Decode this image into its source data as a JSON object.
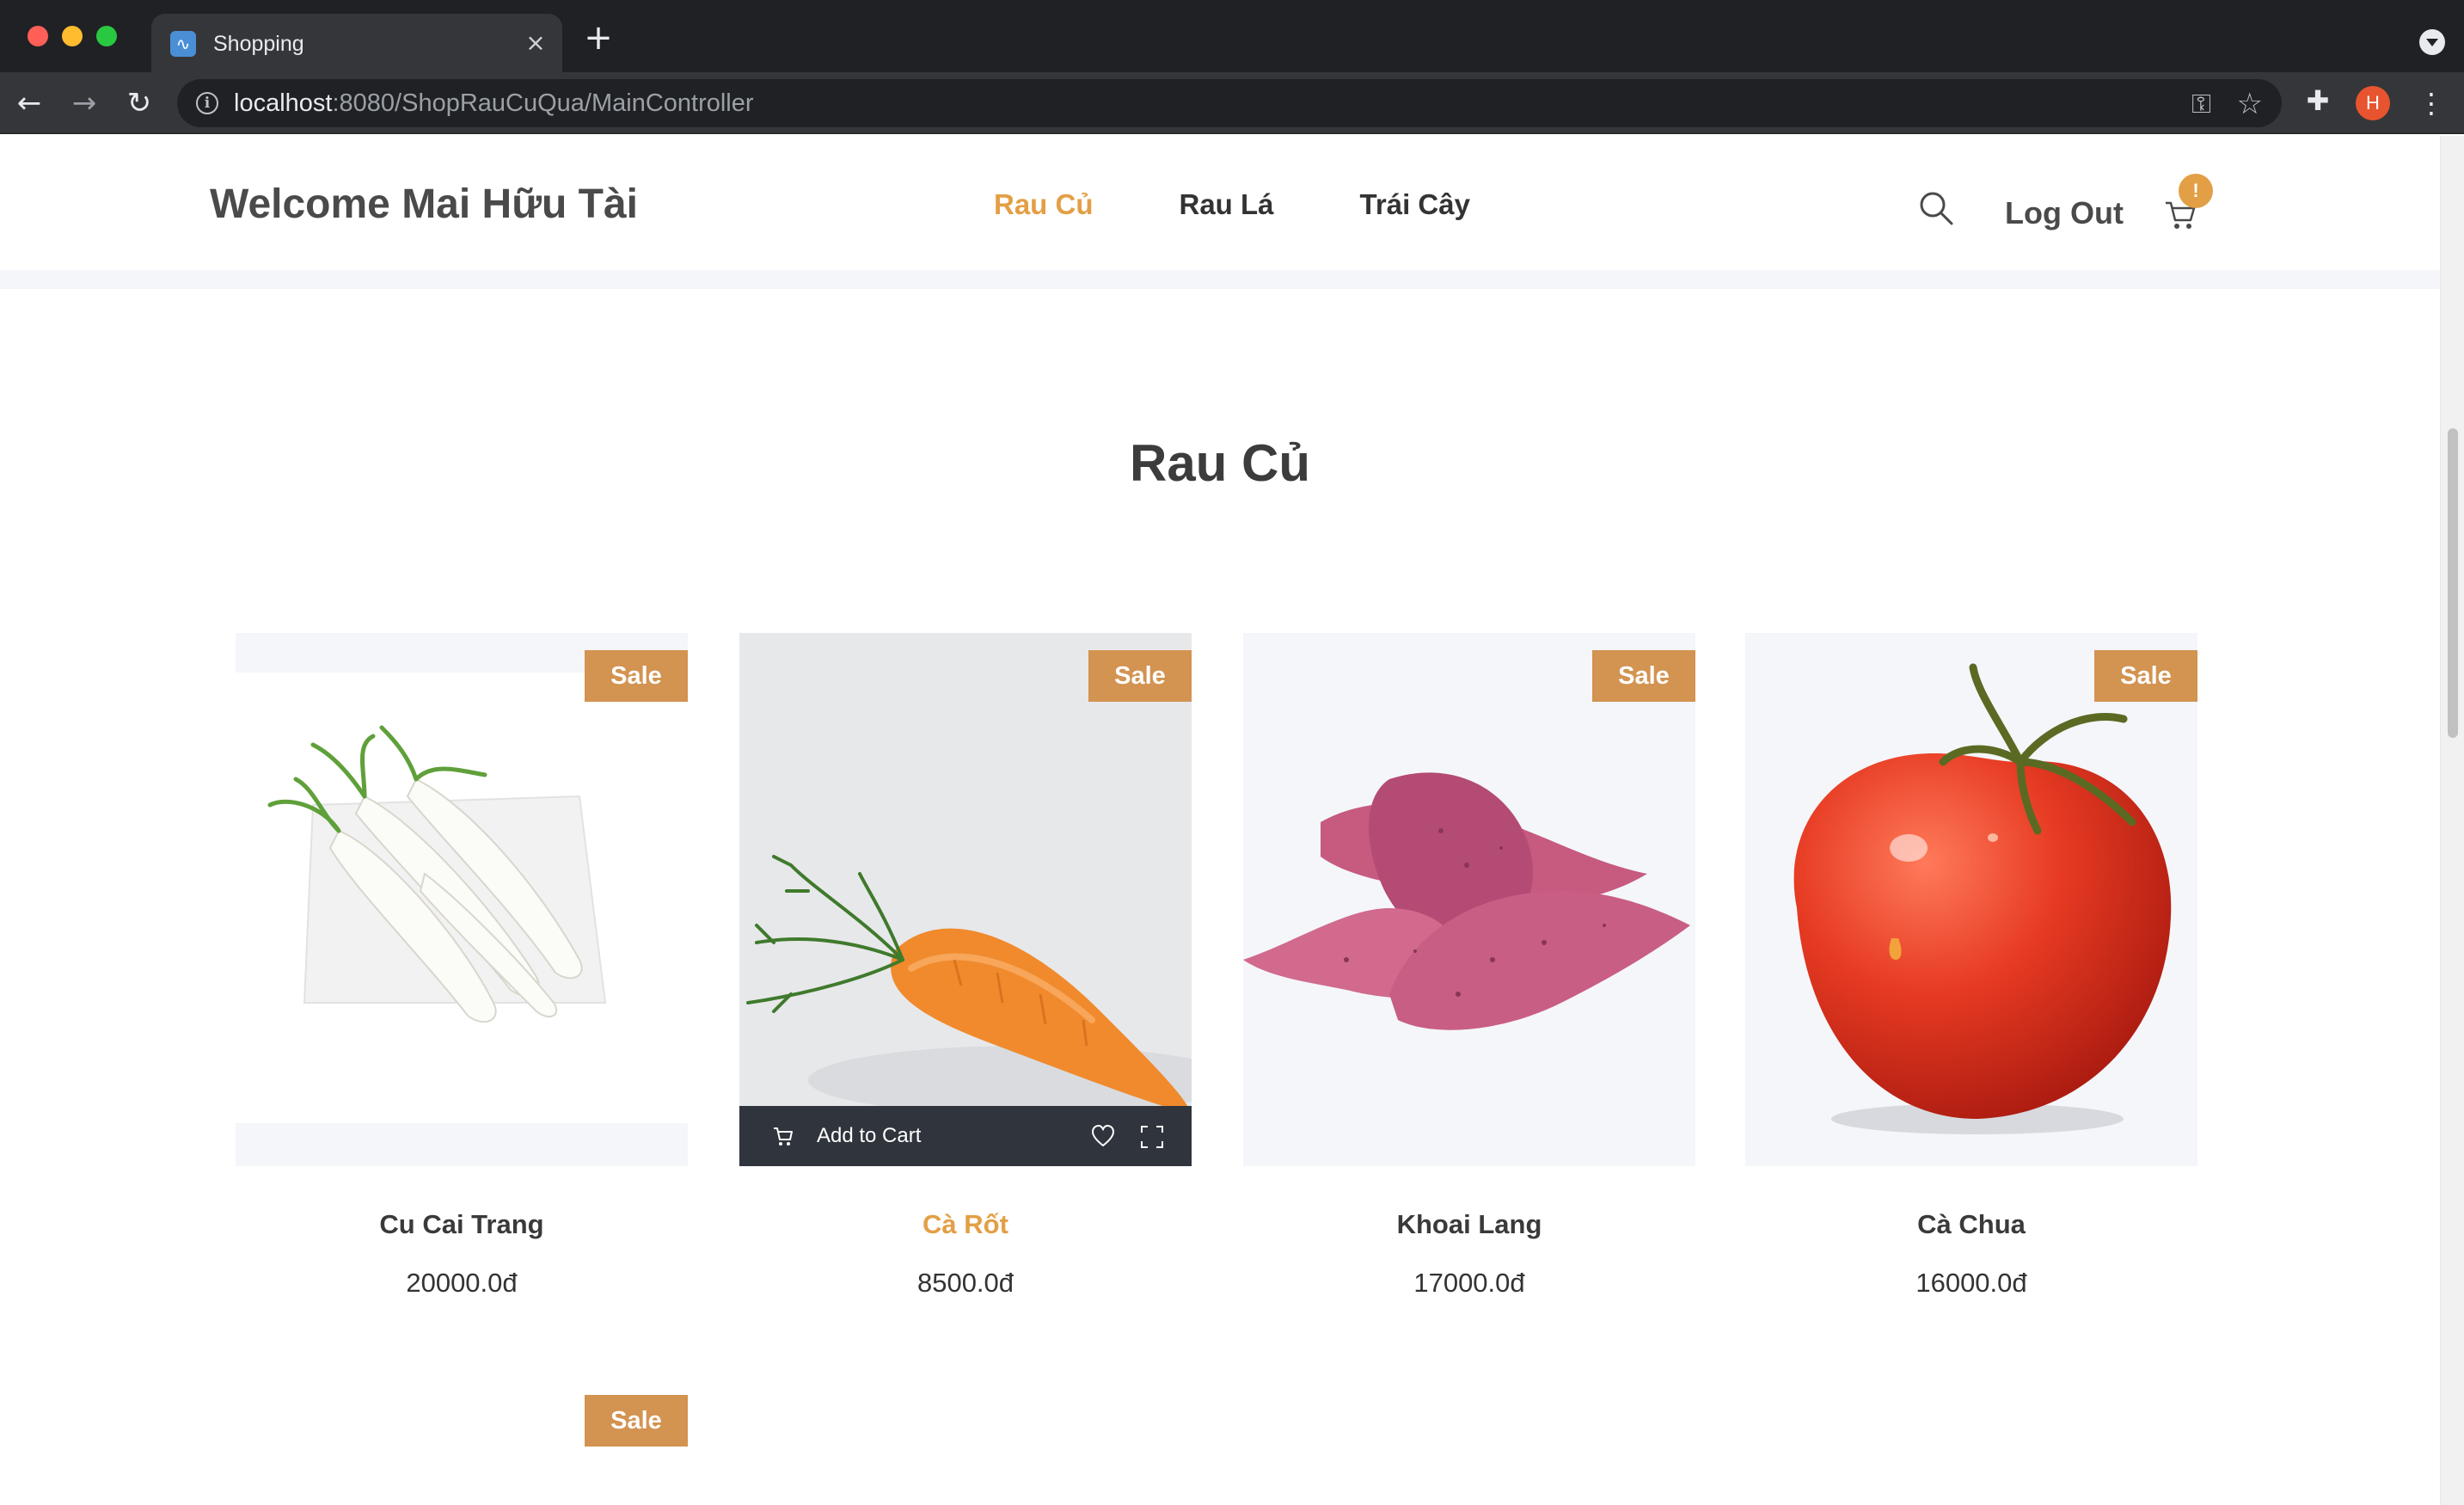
{
  "browser": {
    "tab_title": "Shopping",
    "url_host": "localhost",
    "url_path": ":8080/ShopRauCuQua/MainController",
    "profile_initial": "H"
  },
  "header": {
    "welcome": "Welcome Mai Hữu Tài",
    "menu": [
      {
        "label": "Rau Củ",
        "active": true
      },
      {
        "label": "Rau Lá",
        "active": false
      },
      {
        "label": "Trái Cây",
        "active": false
      }
    ],
    "logout_label": "Log Out",
    "cart_badge": "!"
  },
  "section": {
    "title": "Rau Củ"
  },
  "products": [
    {
      "name": "Cu Cai Trang",
      "price": "20000.0đ",
      "badge": "Sale",
      "image": "white-radish-image"
    },
    {
      "name": "Cà Rốt",
      "price": "8500.0đ",
      "badge": "Sale",
      "image": "carrot-image",
      "hovered": true
    },
    {
      "name": "Khoai Lang",
      "price": "17000.0đ",
      "badge": "Sale",
      "image": "sweet-potato-image"
    },
    {
      "name": "Cà Chua",
      "price": "16000.0đ",
      "badge": "Sale",
      "image": "tomato-image"
    }
  ],
  "hover_bar": {
    "add_to_cart_label": "Add to Cart"
  },
  "next_row": {
    "badge": "Sale"
  },
  "icons": {
    "accent": "#e39f45",
    "sale_badge": "#d39351"
  }
}
